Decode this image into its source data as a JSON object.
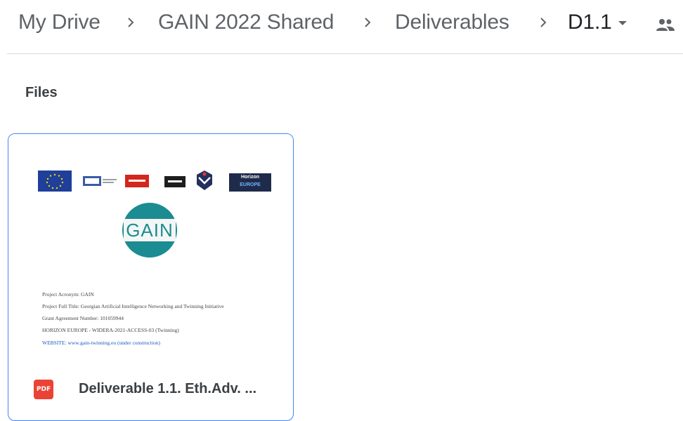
{
  "breadcrumb": {
    "items": [
      "My Drive",
      "GAIN 2022 Shared",
      "Deliverables"
    ],
    "current": "D1.1",
    "icons": {
      "separator": "chevron-right-icon",
      "dropdown": "arrow-drop-down-icon",
      "shared": "people-icon"
    }
  },
  "section": {
    "title": "Files"
  },
  "file": {
    "name": "Deliverable 1.1. Eth.Adv. ...",
    "type_icon": "PDF",
    "accent": "#4285f4",
    "pdf_color": "#ea4335",
    "thumbnail": {
      "logos": [
        "Horizon",
        "EUROPE"
      ],
      "logo_text": "GAIN",
      "lines": [
        "Project Acronym: GAIN",
        "Project Full Title: Georgian Artificial Intelligence Networking and Twinning Initiative",
        "Grant Agreement Number: 101059944",
        "HORIZON EUROPE - WIDERA-2021-ACCESS-03 (Twinning)",
        "WEBSITE: www.gain-twinning.eu (under construction)"
      ]
    }
  }
}
